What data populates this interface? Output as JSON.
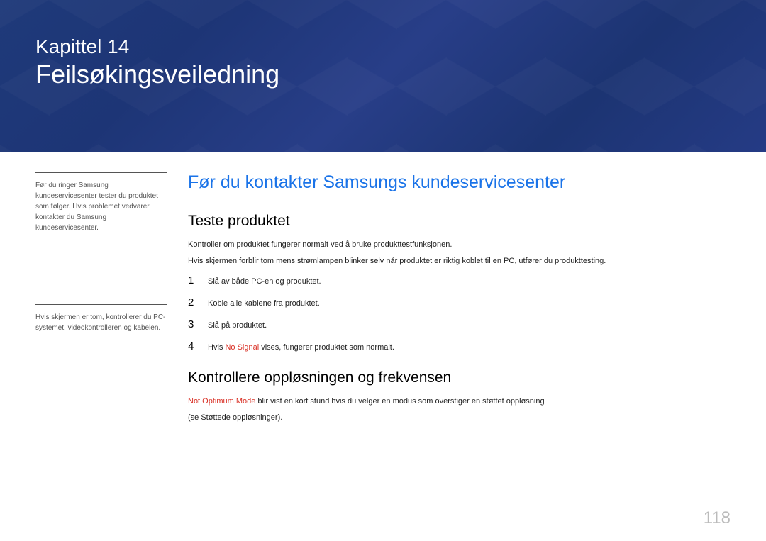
{
  "banner": {
    "chapter_label": "Kapittel 14",
    "chapter_title": "Feilsøkingsveiledning"
  },
  "sidebar": {
    "note1": "Før du ringer Samsung kundeservicesenter tester du produktet som følger. Hvis problemet vedvarer, kontakter du Samsung kundeservicesenter.",
    "note2": "Hvis skjermen er tom, kontrollerer du PC-systemet, videokontrolleren og kabelen."
  },
  "main": {
    "section_title": "Før du kontakter Samsungs kundeservicesenter",
    "sub1_title": "Teste produktet",
    "sub1_p1": "Kontroller om produktet fungerer normalt ved å bruke produkttestfunksjonen.",
    "sub1_p2": "Hvis skjermen forblir tom mens strømlampen blinker selv når produktet er riktig koblet til en PC, utfører du produkttesting.",
    "steps": [
      {
        "n": "1",
        "text": "Slå av både PC-en og produktet."
      },
      {
        "n": "2",
        "text": "Koble alle kablene fra produktet."
      },
      {
        "n": "3",
        "text": "Slå på produktet."
      },
      {
        "n": "4",
        "prefix": "Hvis ",
        "red": "No Signal",
        "suffix": " vises, fungerer produktet som normalt."
      }
    ],
    "sub2_title": "Kontrollere oppløsningen og frekvensen",
    "sub2_red": "Not Optimum Mode",
    "sub2_rest": " blir vist en kort stund hvis du velger en modus som overstiger en støttet oppløsning",
    "sub2_line2": "(se Støttede oppløsninger)."
  },
  "page_number": "118"
}
